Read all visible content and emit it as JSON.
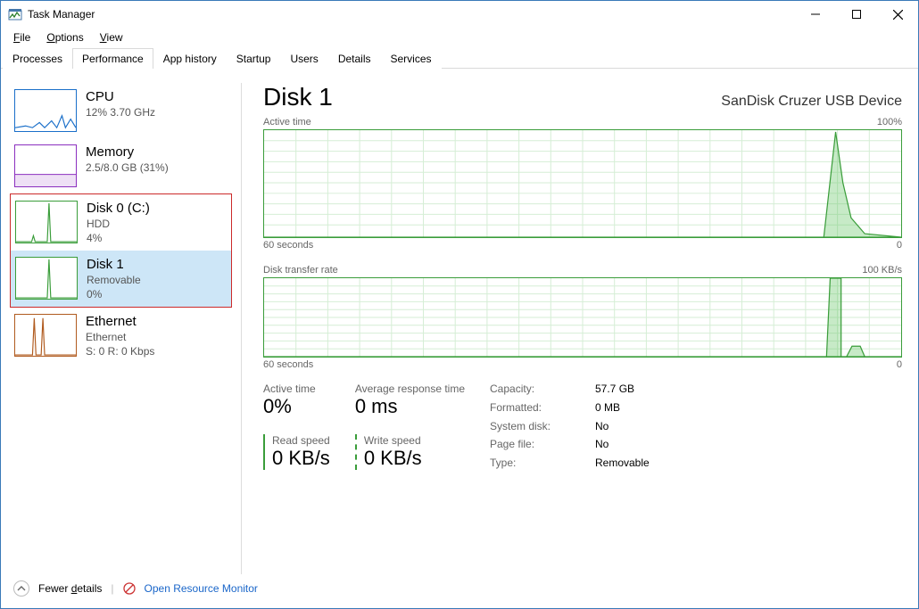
{
  "window": {
    "title": "Task Manager"
  },
  "menu": {
    "file": "File",
    "options": "Options",
    "view": "View"
  },
  "tabs": [
    {
      "label": "Processes"
    },
    {
      "label": "Performance"
    },
    {
      "label": "App history"
    },
    {
      "label": "Startup"
    },
    {
      "label": "Users"
    },
    {
      "label": "Details"
    },
    {
      "label": "Services"
    }
  ],
  "sidebar": {
    "items": [
      {
        "title": "CPU",
        "sub1": "12% 3.70 GHz"
      },
      {
        "title": "Memory",
        "sub1": "2.5/8.0 GB (31%)"
      },
      {
        "title": "Disk 0 (C:)",
        "sub1": "HDD",
        "sub2": "4%"
      },
      {
        "title": "Disk 1",
        "sub1": "Removable",
        "sub2": "0%"
      },
      {
        "title": "Ethernet",
        "sub1": "Ethernet",
        "sub2": "S: 0 R: 0 Kbps"
      }
    ]
  },
  "main": {
    "title": "Disk 1",
    "device": "SanDisk Cruzer USB Device",
    "chart1": {
      "top_left": "Active time",
      "top_right": "100%",
      "bottom_left": "60 seconds",
      "bottom_right": "0"
    },
    "chart2": {
      "top_left": "Disk transfer rate",
      "top_right": "100 KB/s",
      "bottom_left": "60 seconds",
      "bottom_right": "0"
    },
    "stats": {
      "active_label": "Active time",
      "active_value": "0%",
      "resp_label": "Average response time",
      "resp_value": "0 ms",
      "read_label": "Read speed",
      "read_value": "0 KB/s",
      "write_label": "Write speed",
      "write_value": "0 KB/s"
    },
    "kv": {
      "capacity_l": "Capacity:",
      "capacity_v": "57.7 GB",
      "formatted_l": "Formatted:",
      "formatted_v": "0 MB",
      "systemdisk_l": "System disk:",
      "systemdisk_v": "No",
      "pagefile_l": "Page file:",
      "pagefile_v": "No",
      "type_l": "Type:",
      "type_v": "Removable"
    }
  },
  "footer": {
    "fewer": "Fewer details",
    "resmon": "Open Resource Monitor"
  },
  "chart_data": [
    {
      "type": "area",
      "title": "Active time",
      "ylabel": "",
      "ylim": [
        0,
        100
      ],
      "x_range_seconds": [
        60,
        0
      ],
      "series": [
        {
          "name": "Active time %",
          "values_estimate": "0 for ~0-54s; single spike to ~100% near 55s; decays to 0 by 60s"
        }
      ]
    },
    {
      "type": "area",
      "title": "Disk transfer rate",
      "ylabel": "KB/s",
      "ylim": [
        0,
        100
      ],
      "x_range_seconds": [
        60,
        0
      ],
      "series": [
        {
          "name": "Transfer rate",
          "values_estimate": "0 for ~0-54s; spike to ~100 KB/s near 55s; small bump ~15 KB/s near 57s; 0 after"
        }
      ]
    }
  ]
}
